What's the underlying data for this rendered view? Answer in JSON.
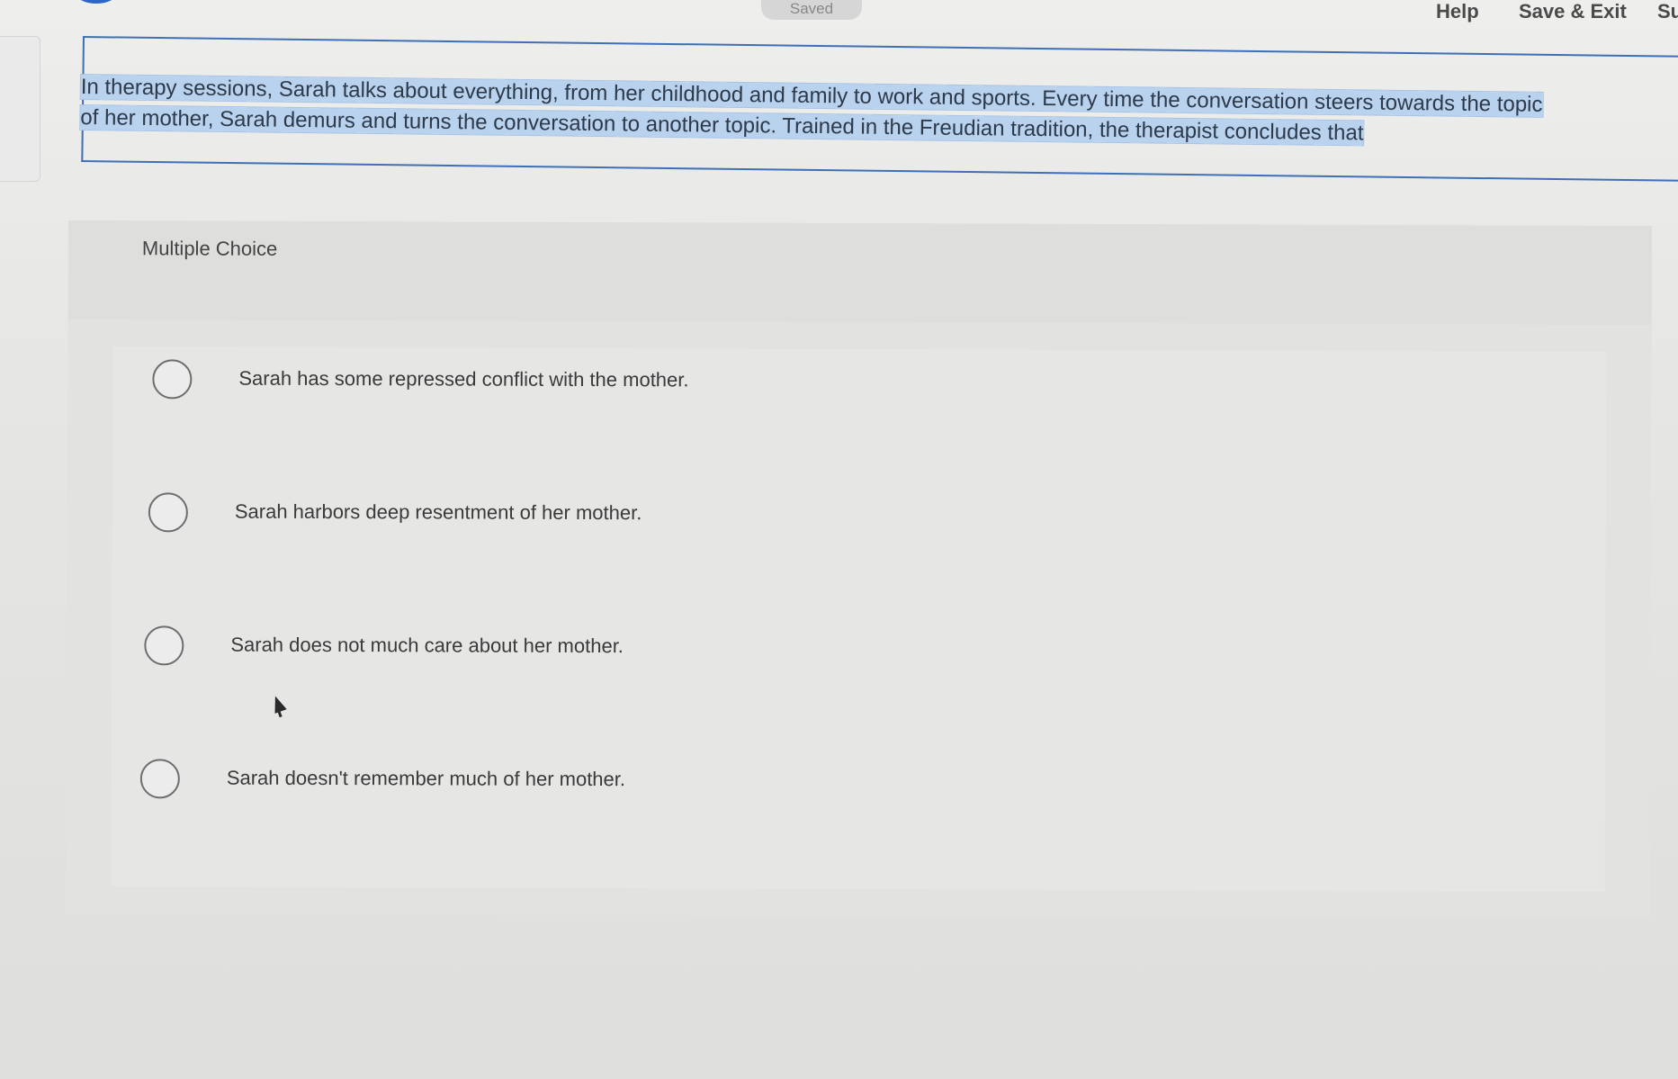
{
  "header": {
    "saved_label": "Saved",
    "help_label": "Help",
    "save_exit_label": "Save & Exit",
    "submit_label_partial": "Su"
  },
  "question": {
    "line1": "In therapy sessions, Sarah talks about everything, from her childhood and family to work and sports. Every time the conversation steers towards the topic",
    "line2": "of her mother, Sarah demurs and turns the conversation to another topic. Trained in the Freudian tradition, the therapist concludes that"
  },
  "multiple_choice": {
    "type_label": "Multiple Choice",
    "options": [
      {
        "label": "Sarah has some repressed conflict with the mother.",
        "selected": false
      },
      {
        "label": "Sarah harbors deep resentment of her mother.",
        "selected": false
      },
      {
        "label": "Sarah does not much care about her mother.",
        "selected": false
      },
      {
        "label": "Sarah doesn't remember much of her mother.",
        "selected": false
      }
    ]
  },
  "colors": {
    "highlight": "#b9d2ee",
    "frame_border": "#3f6fb8",
    "accent_blue": "#2c67c7"
  }
}
